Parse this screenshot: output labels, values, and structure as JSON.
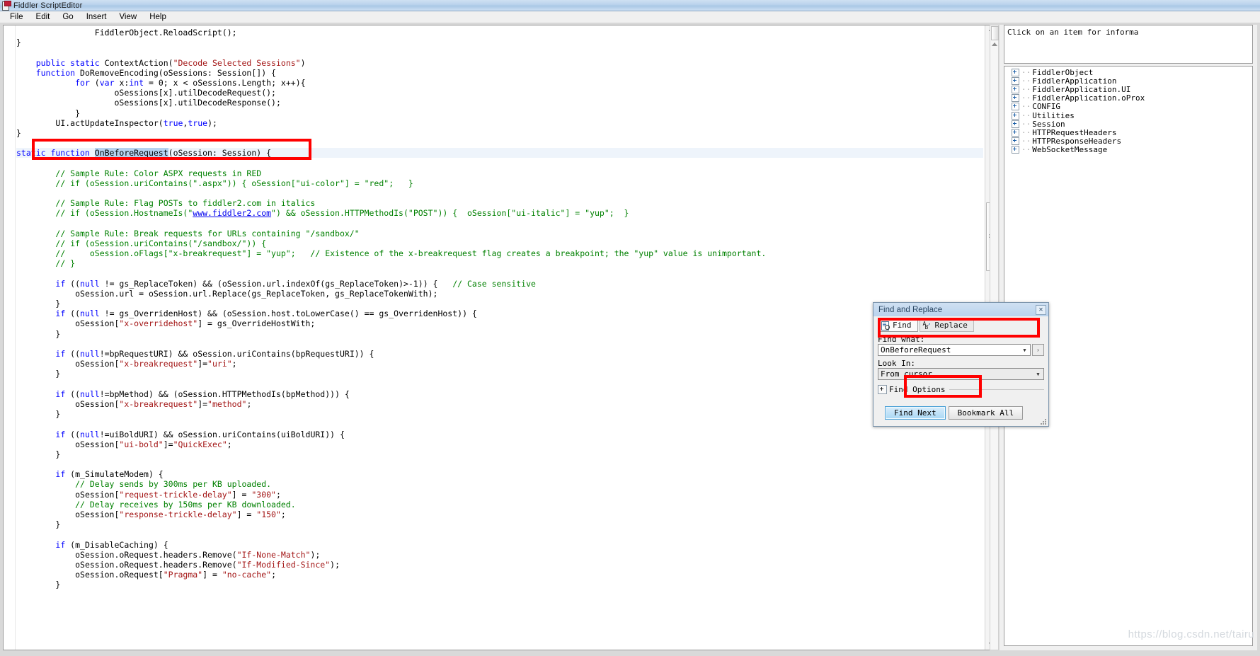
{
  "window": {
    "title": "Fiddler ScriptEditor",
    "icon": "script-document-icon"
  },
  "menu": {
    "items": [
      "File",
      "Edit",
      "Go",
      "Insert",
      "View",
      "Help"
    ]
  },
  "editor": {
    "code_lines": [
      {
        "indent": 4,
        "parts": [
          {
            "t": "FiddlerObject.ReloadScript();",
            "c": ""
          }
        ]
      },
      {
        "indent": 0,
        "parts": [
          {
            "t": "}",
            "c": ""
          }
        ]
      },
      {
        "indent": 0,
        "parts": [
          {
            "t": "",
            "c": ""
          }
        ]
      },
      {
        "indent": 1,
        "parts": [
          {
            "t": "public static ",
            "c": "kw"
          },
          {
            "t": "ContextAction(",
            "c": ""
          },
          {
            "t": "\"Decode Selected Sessions\"",
            "c": "str"
          },
          {
            "t": ")",
            "c": ""
          }
        ]
      },
      {
        "indent": 1,
        "parts": [
          {
            "t": "function ",
            "c": "kw"
          },
          {
            "t": "DoRemoveEncoding(oSessions: Session[]) {",
            "c": ""
          }
        ]
      },
      {
        "indent": 3,
        "parts": [
          {
            "t": "for ",
            "c": "kw"
          },
          {
            "t": "(",
            "c": ""
          },
          {
            "t": "var ",
            "c": "kw"
          },
          {
            "t": "x:",
            "c": ""
          },
          {
            "t": "int ",
            "c": "kw"
          },
          {
            "t": "= 0; x < oSessions.Length; x++){",
            "c": ""
          }
        ]
      },
      {
        "indent": 5,
        "parts": [
          {
            "t": "oSessions[x].utilDecodeRequest();",
            "c": ""
          }
        ]
      },
      {
        "indent": 5,
        "parts": [
          {
            "t": "oSessions[x].utilDecodeResponse();",
            "c": ""
          }
        ]
      },
      {
        "indent": 3,
        "parts": [
          {
            "t": "}",
            "c": ""
          }
        ]
      },
      {
        "indent": 2,
        "parts": [
          {
            "t": "UI.actUpdateInspector(",
            "c": ""
          },
          {
            "t": "true",
            "c": "kw"
          },
          {
            "t": ",",
            "c": ""
          },
          {
            "t": "true",
            "c": "kw"
          },
          {
            "t": ");",
            "c": ""
          }
        ]
      },
      {
        "indent": 0,
        "parts": [
          {
            "t": "}",
            "c": ""
          }
        ]
      },
      {
        "indent": 0,
        "parts": [
          {
            "t": "",
            "c": ""
          }
        ]
      },
      {
        "indent": 0,
        "highlight": true,
        "parts": [
          {
            "t": "static function ",
            "c": "kw"
          },
          {
            "t": "OnBeforeRequest",
            "c": "sel"
          },
          {
            "t": "(oSession: Session) {",
            "c": ""
          }
        ]
      },
      {
        "indent": 2,
        "parts": [
          {
            "t": "// Sample Rule: Color ASPX requests in RED",
            "c": "cmt"
          }
        ]
      },
      {
        "indent": 2,
        "parts": [
          {
            "t": "// if (oSession.uriContains(\".aspx\")) { oSession[\"ui-color\"] = \"red\";   }",
            "c": "cmt"
          }
        ]
      },
      {
        "indent": 0,
        "parts": [
          {
            "t": "",
            "c": ""
          }
        ]
      },
      {
        "indent": 2,
        "parts": [
          {
            "t": "// Sample Rule: Flag POSTs to fiddler2.com in italics",
            "c": "cmt"
          }
        ]
      },
      {
        "indent": 2,
        "parts": [
          {
            "t": "// if (oSession.HostnameIs(\"",
            "c": "cmt"
          },
          {
            "t": "www.fiddler2.com",
            "c": "url"
          },
          {
            "t": "\") && oSession.HTTPMethodIs(\"POST\")) {  oSession[\"ui-italic\"] = \"yup\";  }",
            "c": "cmt"
          }
        ]
      },
      {
        "indent": 0,
        "parts": [
          {
            "t": "",
            "c": ""
          }
        ]
      },
      {
        "indent": 2,
        "parts": [
          {
            "t": "// Sample Rule: Break requests for URLs containing \"/sandbox/\"",
            "c": "cmt"
          }
        ]
      },
      {
        "indent": 2,
        "parts": [
          {
            "t": "// if (oSession.uriContains(\"/sandbox/\")) {",
            "c": "cmt"
          }
        ]
      },
      {
        "indent": 2,
        "parts": [
          {
            "t": "//     oSession.oFlags[\"x-breakrequest\"] = \"yup\";   // Existence of the x-breakrequest flag creates a breakpoint; the \"yup\" value is unimportant.",
            "c": "cmt"
          }
        ]
      },
      {
        "indent": 2,
        "parts": [
          {
            "t": "// }",
            "c": "cmt"
          }
        ]
      },
      {
        "indent": 0,
        "parts": [
          {
            "t": "",
            "c": ""
          }
        ]
      },
      {
        "indent": 2,
        "parts": [
          {
            "t": "if ",
            "c": "kw"
          },
          {
            "t": "((",
            "c": ""
          },
          {
            "t": "null ",
            "c": "kw"
          },
          {
            "t": "!= gs_ReplaceToken) && (oSession.url.indexOf(gs_ReplaceToken)>-1)) {   ",
            "c": ""
          },
          {
            "t": "// Case sensitive",
            "c": "cmt"
          }
        ]
      },
      {
        "indent": 3,
        "parts": [
          {
            "t": "oSession.url = oSession.url.Replace(gs_ReplaceToken, gs_ReplaceTokenWith);",
            "c": ""
          }
        ]
      },
      {
        "indent": 2,
        "parts": [
          {
            "t": "}",
            "c": ""
          }
        ]
      },
      {
        "indent": 2,
        "parts": [
          {
            "t": "if ",
            "c": "kw"
          },
          {
            "t": "((",
            "c": ""
          },
          {
            "t": "null ",
            "c": "kw"
          },
          {
            "t": "!= gs_OverridenHost) && (oSession.host.toLowerCase() == gs_OverridenHost)) {",
            "c": ""
          }
        ]
      },
      {
        "indent": 3,
        "parts": [
          {
            "t": "oSession[",
            "c": ""
          },
          {
            "t": "\"x-overridehost\"",
            "c": "str"
          },
          {
            "t": "] = gs_OverrideHostWith;",
            "c": ""
          }
        ]
      },
      {
        "indent": 2,
        "parts": [
          {
            "t": "}",
            "c": ""
          }
        ]
      },
      {
        "indent": 0,
        "parts": [
          {
            "t": "",
            "c": ""
          }
        ]
      },
      {
        "indent": 2,
        "parts": [
          {
            "t": "if ",
            "c": "kw"
          },
          {
            "t": "((",
            "c": ""
          },
          {
            "t": "null",
            "c": "kw"
          },
          {
            "t": "!=bpRequestURI) && oSession.uriContains(bpRequestURI)) {",
            "c": ""
          }
        ]
      },
      {
        "indent": 3,
        "parts": [
          {
            "t": "oSession[",
            "c": ""
          },
          {
            "t": "\"x-breakrequest\"",
            "c": "str"
          },
          {
            "t": "]=",
            "c": ""
          },
          {
            "t": "\"uri\"",
            "c": "str"
          },
          {
            "t": ";",
            "c": ""
          }
        ]
      },
      {
        "indent": 2,
        "parts": [
          {
            "t": "}",
            "c": ""
          }
        ]
      },
      {
        "indent": 0,
        "parts": [
          {
            "t": "",
            "c": ""
          }
        ]
      },
      {
        "indent": 2,
        "parts": [
          {
            "t": "if ",
            "c": "kw"
          },
          {
            "t": "((",
            "c": ""
          },
          {
            "t": "null",
            "c": "kw"
          },
          {
            "t": "!=bpMethod) && (oSession.HTTPMethodIs(bpMethod))) {",
            "c": ""
          }
        ]
      },
      {
        "indent": 3,
        "parts": [
          {
            "t": "oSession[",
            "c": ""
          },
          {
            "t": "\"x-breakrequest\"",
            "c": "str"
          },
          {
            "t": "]=",
            "c": ""
          },
          {
            "t": "\"method\"",
            "c": "str"
          },
          {
            "t": ";",
            "c": ""
          }
        ]
      },
      {
        "indent": 2,
        "parts": [
          {
            "t": "}",
            "c": ""
          }
        ]
      },
      {
        "indent": 0,
        "parts": [
          {
            "t": "",
            "c": ""
          }
        ]
      },
      {
        "indent": 2,
        "parts": [
          {
            "t": "if ",
            "c": "kw"
          },
          {
            "t": "((",
            "c": ""
          },
          {
            "t": "null",
            "c": "kw"
          },
          {
            "t": "!=uiBoldURI) && oSession.uriContains(uiBoldURI)) {",
            "c": ""
          }
        ]
      },
      {
        "indent": 3,
        "parts": [
          {
            "t": "oSession[",
            "c": ""
          },
          {
            "t": "\"ui-bold\"",
            "c": "str"
          },
          {
            "t": "]=",
            "c": ""
          },
          {
            "t": "\"QuickExec\"",
            "c": "str"
          },
          {
            "t": ";",
            "c": ""
          }
        ]
      },
      {
        "indent": 2,
        "parts": [
          {
            "t": "}",
            "c": ""
          }
        ]
      },
      {
        "indent": 0,
        "parts": [
          {
            "t": "",
            "c": ""
          }
        ]
      },
      {
        "indent": 2,
        "parts": [
          {
            "t": "if ",
            "c": "kw"
          },
          {
            "t": "(m_SimulateModem) {",
            "c": ""
          }
        ]
      },
      {
        "indent": 3,
        "parts": [
          {
            "t": "// Delay sends by 300ms per KB uploaded.",
            "c": "cmt"
          }
        ]
      },
      {
        "indent": 3,
        "parts": [
          {
            "t": "oSession[",
            "c": ""
          },
          {
            "t": "\"request-trickle-delay\"",
            "c": "str"
          },
          {
            "t": "] = ",
            "c": ""
          },
          {
            "t": "\"300\"",
            "c": "str"
          },
          {
            "t": ";",
            "c": ""
          }
        ]
      },
      {
        "indent": 3,
        "parts": [
          {
            "t": "// Delay receives by 150ms per KB downloaded.",
            "c": "cmt"
          }
        ]
      },
      {
        "indent": 3,
        "parts": [
          {
            "t": "oSession[",
            "c": ""
          },
          {
            "t": "\"response-trickle-delay\"",
            "c": "str"
          },
          {
            "t": "] = ",
            "c": ""
          },
          {
            "t": "\"150\"",
            "c": "str"
          },
          {
            "t": ";",
            "c": ""
          }
        ]
      },
      {
        "indent": 2,
        "parts": [
          {
            "t": "}",
            "c": ""
          }
        ]
      },
      {
        "indent": 0,
        "parts": [
          {
            "t": "",
            "c": ""
          }
        ]
      },
      {
        "indent": 2,
        "parts": [
          {
            "t": "if ",
            "c": "kw"
          },
          {
            "t": "(m_DisableCaching) {",
            "c": ""
          }
        ]
      },
      {
        "indent": 3,
        "parts": [
          {
            "t": "oSession.oRequest.headers.Remove(",
            "c": ""
          },
          {
            "t": "\"If-None-Match\"",
            "c": "str"
          },
          {
            "t": ");",
            "c": ""
          }
        ]
      },
      {
        "indent": 3,
        "parts": [
          {
            "t": "oSession.oRequest.headers.Remove(",
            "c": ""
          },
          {
            "t": "\"If-Modified-Since\"",
            "c": "str"
          },
          {
            "t": ");",
            "c": ""
          }
        ]
      },
      {
        "indent": 3,
        "parts": [
          {
            "t": "oSession.oRequest[",
            "c": ""
          },
          {
            "t": "\"Pragma\"",
            "c": "str"
          },
          {
            "t": "] = ",
            "c": ""
          },
          {
            "t": "\"no-cache\"",
            "c": "str"
          },
          {
            "t": ";",
            "c": ""
          }
        ]
      },
      {
        "indent": 2,
        "parts": [
          {
            "t": "}",
            "c": ""
          }
        ]
      }
    ]
  },
  "right_panel": {
    "info_text": "Click on an item for informa",
    "tree_items": [
      "FiddlerObject",
      "FiddlerApplication",
      "FiddlerApplication.UI",
      "FiddlerApplication.oProx",
      "CONFIG",
      "Utilities",
      "Session",
      "HTTPRequestHeaders",
      "HTTPResponseHeaders",
      "WebSocketMessage"
    ]
  },
  "find_dialog": {
    "title": "Find and Replace",
    "close_label": "✕",
    "tabs": [
      {
        "label": "Find",
        "icon": "find-document-icon",
        "active": true
      },
      {
        "label": "Replace",
        "icon": "replace-icon",
        "active": false
      }
    ],
    "find_what_label": "Find what:",
    "find_what_value": "OnBeforeRequest",
    "expand_button_label": "›",
    "look_in_label": "Look In:",
    "look_in_value": "From cursor",
    "find_options_label": "Find Options",
    "find_next_label": "Find Next",
    "bookmark_all_label": "Bookmark All"
  },
  "annotations": {
    "accent_color": "#ff0000",
    "boxes": [
      {
        "name": "code-line-highlight"
      },
      {
        "name": "find-input-highlight"
      },
      {
        "name": "find-next-highlight"
      }
    ]
  },
  "watermark": {
    "text": "https://blog.csdn.net/tairu"
  }
}
